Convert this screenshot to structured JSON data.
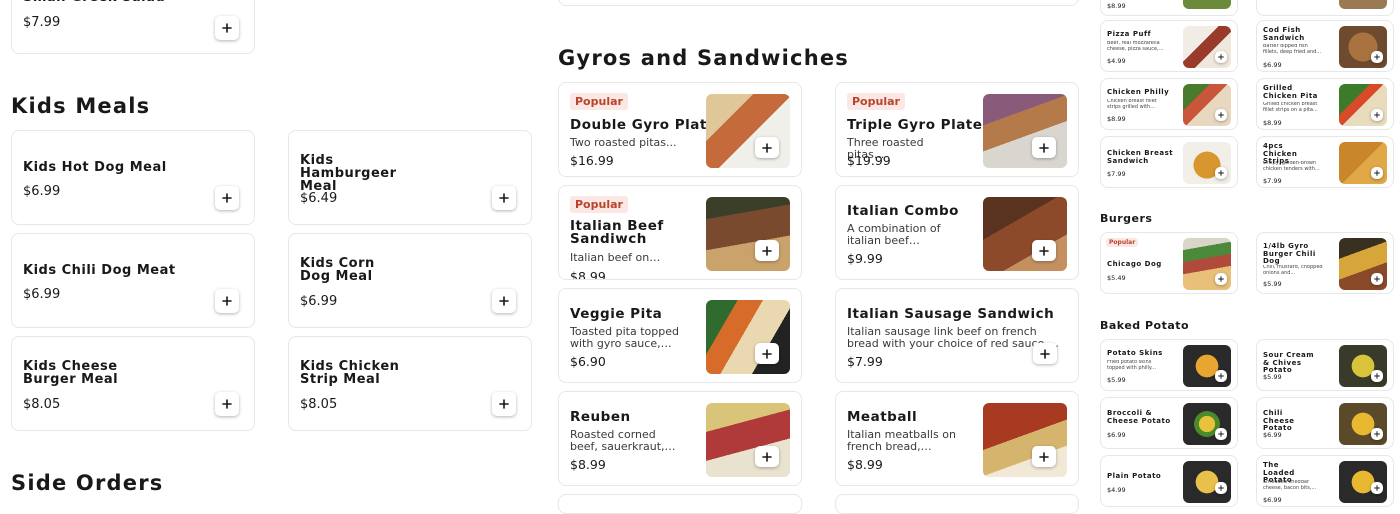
{
  "left": {
    "top_price": "$7.99",
    "kids_meals_title": "Kids Meals",
    "kids": [
      {
        "name": "Kids Hot Dog Meal",
        "price": "$6.99"
      },
      {
        "name": "Kids Hamburgeer Meal",
        "price": "$6.49"
      },
      {
        "name": "Kids Chili Dog Meat",
        "price": "$6.99"
      },
      {
        "name": "Kids Corn Dog Meal",
        "price": "$6.99"
      },
      {
        "name": "Kids Cheese Burger Meal",
        "price": "$8.05"
      },
      {
        "name": "Kids Chicken Strip Meal",
        "price": "$8.05"
      }
    ],
    "side_orders_title": "Side Orders"
  },
  "middle": {
    "title": "Gyros and Sandwiches",
    "items": [
      {
        "badge": "Popular",
        "name": "Double Gyro Plate",
        "desc": "Two roasted pitas...",
        "price": "$16.99"
      },
      {
        "badge": "Popular",
        "name": "Triple Gyro Plate",
        "desc": "Three roasted pitas...",
        "price": "$19.99"
      },
      {
        "badge": "Popular",
        "name": "Italian Beef Sandiwch",
        "desc": "Italian beef on french...",
        "price": "$8.99"
      },
      {
        "badge": "",
        "name": "Italian Combo",
        "desc": "A combination of italian beef and...",
        "price": "$9.99"
      },
      {
        "badge": "",
        "name": "Veggie Pita",
        "desc": "Toasted pita topped with gyro sauce, feta...",
        "price": "$6.90"
      },
      {
        "badge": "",
        "name": "Italian Sausage Sandwich",
        "desc": "Italian sausage link beef on french bread with your choice of red sauce or homemade...",
        "price": "$7.99"
      },
      {
        "badge": "",
        "name": "Reuben",
        "desc": "Roasted corned beef, sauerkraut, swiss on...",
        "price": "$8.99"
      },
      {
        "badge": "",
        "name": "Meatball",
        "desc": "Italian meatballs on french bread, melted...",
        "price": "$8.99"
      }
    ]
  },
  "right": {
    "top_prices": [
      "$8.99",
      ""
    ],
    "sandwich_items": [
      {
        "name": "Pizza Puff",
        "desc": "Beef, real mozzarella cheese, pizza sauce,...",
        "price": "$4.99"
      },
      {
        "name": "Cod Fish Sandwich",
        "desc": "Batter dipped fish fillets, deep fried and...",
        "price": "$6.99"
      },
      {
        "name": "Chicken Philly",
        "desc": "Chicken breast fillet strips grilled with...",
        "price": "$8.99"
      },
      {
        "name": "Grilled Chicken Pita",
        "desc": "Grilled chicken breast fillet strips on a pita...",
        "price": "$8.99"
      },
      {
        "name": "Chicken Breast Sandwich",
        "desc": "",
        "price": "$7.99"
      },
      {
        "name": "4pcs Chicken Strips",
        "desc": "Crispy, golden-brown chicken tenders with...",
        "price": "$7.99"
      }
    ],
    "burgers_title": "Burgers",
    "burgers": [
      {
        "badge": "Popular",
        "name": "Chicago Dog",
        "desc": "",
        "price": "$5.49"
      },
      {
        "badge": "",
        "name": "1/4lb Gyro Burger Chili Dog",
        "desc": "Chili, mustard, chopped onions and...",
        "price": "$5.99"
      }
    ],
    "baked_title": "Baked Potato",
    "baked": [
      {
        "name": "Potato Skins",
        "desc": "Fried potato skins topped with philly...",
        "price": "$5.99"
      },
      {
        "name": "Sour Cream & Chives Potato",
        "desc": "",
        "price": "$5.99"
      },
      {
        "name": "Broccoli & Cheese Potato",
        "desc": "",
        "price": "$6.99"
      },
      {
        "name": "Chili Cheese Potato",
        "desc": "",
        "price": "$6.99"
      },
      {
        "name": "Plain Potato",
        "desc": "",
        "price": "$4.99"
      },
      {
        "name": "The Loaded Potato",
        "desc": "Shredded cheddar cheese, bacon bits,...",
        "price": "$6.99"
      }
    ]
  },
  "icons": {
    "add": "plus-icon"
  },
  "colors": {
    "badge_bg": "#fbe7e3",
    "badge_text": "#b8442b"
  }
}
